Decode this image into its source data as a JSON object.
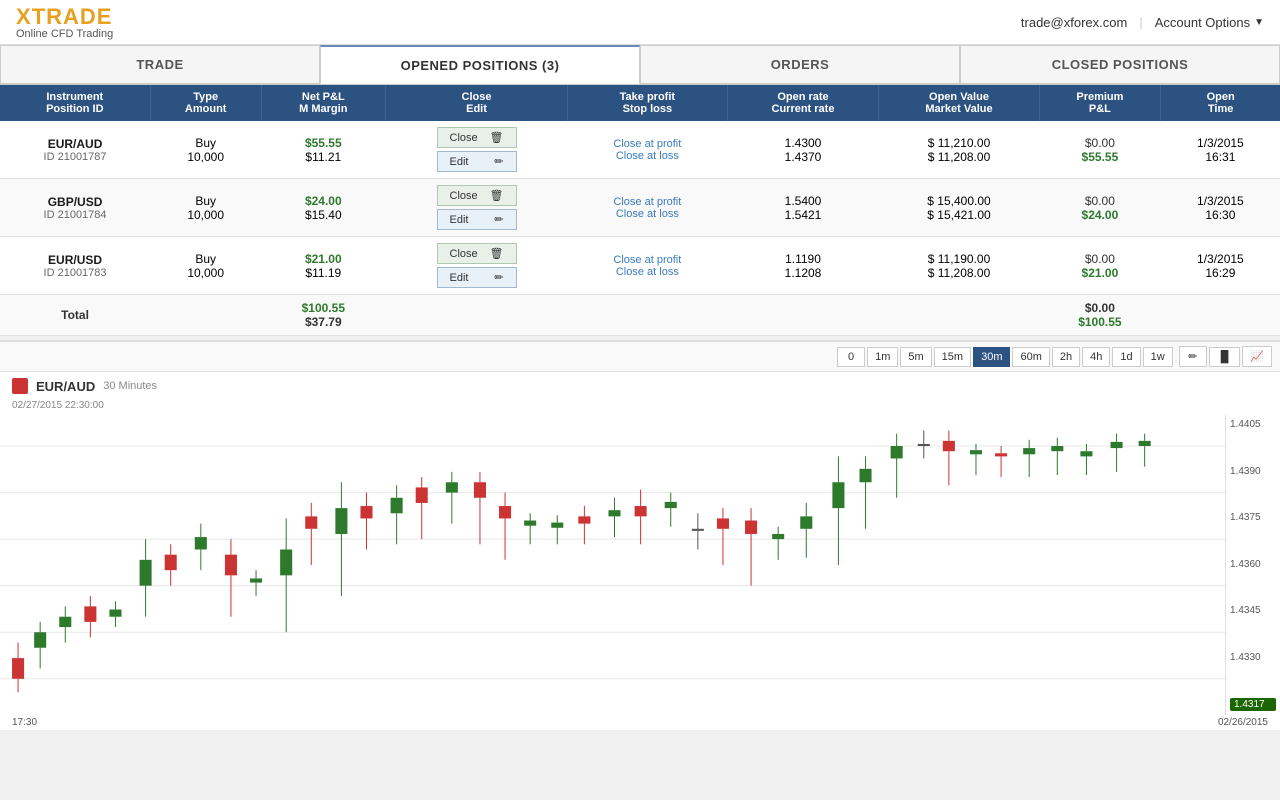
{
  "header": {
    "logo_text_x": "X",
    "logo_text_trade": "TRADE",
    "logo_sub": "Online CFD Trading",
    "user_email": "trade@xforex.com",
    "account_options_label": "Account Options"
  },
  "nav": {
    "tabs": [
      {
        "id": "trade",
        "label": "TRADE",
        "active": false
      },
      {
        "id": "opened",
        "label": "OPENED POSITIONS (3)",
        "active": true
      },
      {
        "id": "orders",
        "label": "ORDERS",
        "active": false
      },
      {
        "id": "closed",
        "label": "CLOSED POSITIONS",
        "active": false
      }
    ]
  },
  "table": {
    "headers": [
      {
        "line1": "Instrument",
        "line2": "Position ID"
      },
      {
        "line1": "Type",
        "line2": "Amount"
      },
      {
        "line1": "Net P&L",
        "line2": "M Margin"
      },
      {
        "line1": "Close",
        "line2": "Edit"
      },
      {
        "line1": "Take profit",
        "line2": "Stop loss"
      },
      {
        "line1": "Open rate",
        "line2": "Current rate"
      },
      {
        "line1": "Open Value",
        "line2": "Market Value"
      },
      {
        "line1": "Premium",
        "line2": "P&L"
      },
      {
        "line1": "Open",
        "line2": "Time"
      }
    ],
    "rows": [
      {
        "instrument": "EUR/AUD",
        "position_id": "ID 21001787",
        "type": "Buy",
        "amount": "10,000",
        "net_pnl": "$55.55",
        "m_margin": "$11.21",
        "close_at_profit": "Close at profit",
        "close_at_loss": "Close at loss",
        "open_rate": "1.4300",
        "current_rate": "1.4370",
        "open_value": "$ 11,210.00",
        "market_value": "$ 11,208.00",
        "premium": "$0.00",
        "pnl": "$55.55",
        "open_date": "1/3/2015",
        "open_time": "16:31"
      },
      {
        "instrument": "GBP/USD",
        "position_id": "ID 21001784",
        "type": "Buy",
        "amount": "10,000",
        "net_pnl": "$24.00",
        "m_margin": "$15.40",
        "close_at_profit": "Close at profit",
        "close_at_loss": "Close at loss",
        "open_rate": "1.5400",
        "current_rate": "1.5421",
        "open_value": "$ 15,400.00",
        "market_value": "$ 15,421.00",
        "premium": "$0.00",
        "pnl": "$24.00",
        "open_date": "1/3/2015",
        "open_time": "16:30"
      },
      {
        "instrument": "EUR/USD",
        "position_id": "ID 21001783",
        "type": "Buy",
        "amount": "10,000",
        "net_pnl": "$21.00",
        "m_margin": "$11.19",
        "close_at_profit": "Close at profit",
        "close_at_loss": "Close at loss",
        "open_rate": "1.1190",
        "current_rate": "1.1208",
        "open_value": "$ 11,190.00",
        "market_value": "$ 11,208.00",
        "premium": "$0.00",
        "pnl": "$21.00",
        "open_date": "1/3/2015",
        "open_time": "16:29"
      }
    ],
    "total": {
      "label": "Total",
      "total_pnl": "$100.55",
      "total_margin": "$37.79",
      "total_premium": "$0.00",
      "total_pl": "$100.55"
    },
    "buttons": {
      "close": "Close",
      "edit": "Edit"
    }
  },
  "chart": {
    "timeframes": [
      "0",
      "1m",
      "5m",
      "15m",
      "30m",
      "60m",
      "2h",
      "4h",
      "1d",
      "1w"
    ],
    "active_timeframe": "30m",
    "instrument": "EUR/AUD",
    "period": "30 Minutes",
    "datetime": "02/27/2015 22:30:00",
    "y_axis": [
      "1.4405",
      "1.4390",
      "1.4375",
      "1.4360",
      "1.4345",
      "1.4330",
      "1.4317"
    ],
    "price_tag": "1.4317",
    "bottom_date_left": "17:30",
    "bottom_date_right": "02/26/2015"
  }
}
